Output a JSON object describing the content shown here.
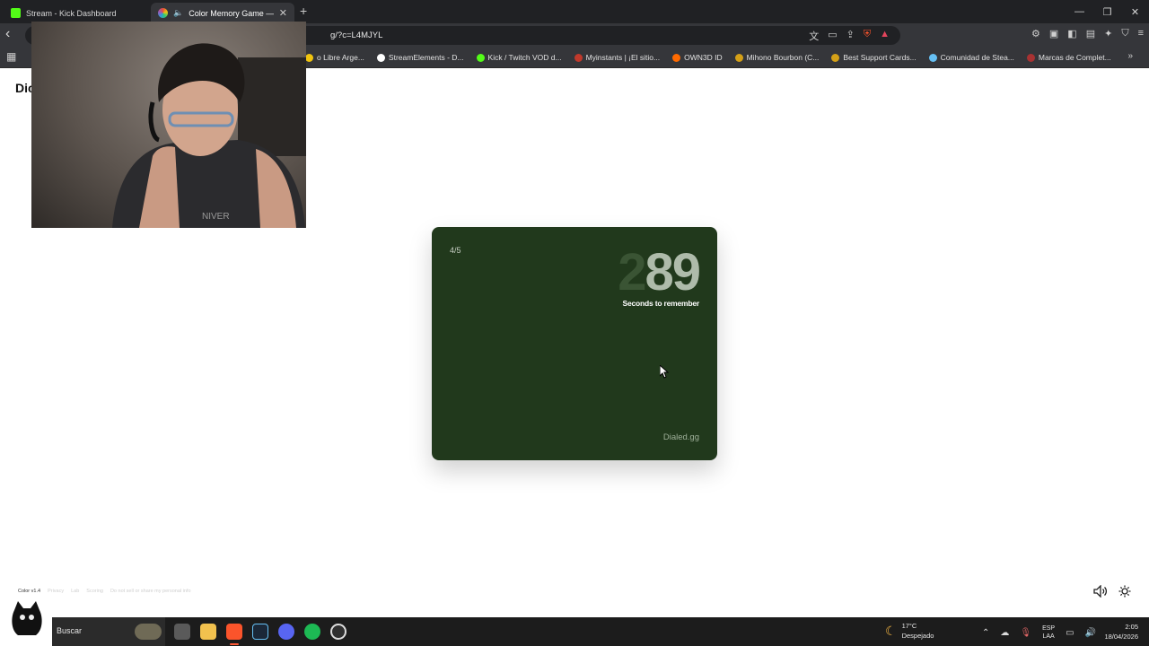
{
  "browser": {
    "tabs": [
      {
        "title": "Stream - Kick Dashboard",
        "favicon_color": "#53fc18"
      },
      {
        "title": "Color Memory Game — How",
        "favicon_color": "#9b59b6",
        "active": true
      }
    ],
    "url": "g/?c=L4MJYL",
    "bookmarks": [
      {
        "label": "o Libre Arge...",
        "color": "#f1c40f"
      },
      {
        "label": "StreamElements - D...",
        "color": "#ffffff"
      },
      {
        "label": "Kick / Twitch VOD d...",
        "color": "#53fc18"
      },
      {
        "label": "Myinstants | ¡El sitio...",
        "color": "#c0392b"
      },
      {
        "label": "OWN3D ID",
        "color": "#ff6a00"
      },
      {
        "label": "Mihono Bourbon (C...",
        "color": "#d4a017"
      },
      {
        "label": "Best Support Cards...",
        "color": "#d4a017"
      },
      {
        "label": "Comunidad de Stea...",
        "color": "#66c0f4"
      },
      {
        "label": "Marcas de Complet...",
        "color": "#a83232"
      }
    ]
  },
  "page": {
    "brand_partial": "Dic",
    "game": {
      "round": "4/5",
      "countdown_prev": "2",
      "countdown_current": "89",
      "countdown_caption": "Seconds to remember",
      "brand": "Dialed.gg",
      "target_color": "#21391c"
    },
    "footer": {
      "version": "Color v1.4",
      "links": [
        "Privacy",
        "Lab",
        "Scoring",
        "Do not sell or share my personal info"
      ]
    }
  },
  "taskbar": {
    "search_label": "Buscar",
    "weather_temp": "17°C",
    "weather_desc": "Despejado",
    "lang_top": "ESP",
    "lang_bottom": "LAA",
    "time": "2:05",
    "date": "18/04/2026"
  }
}
